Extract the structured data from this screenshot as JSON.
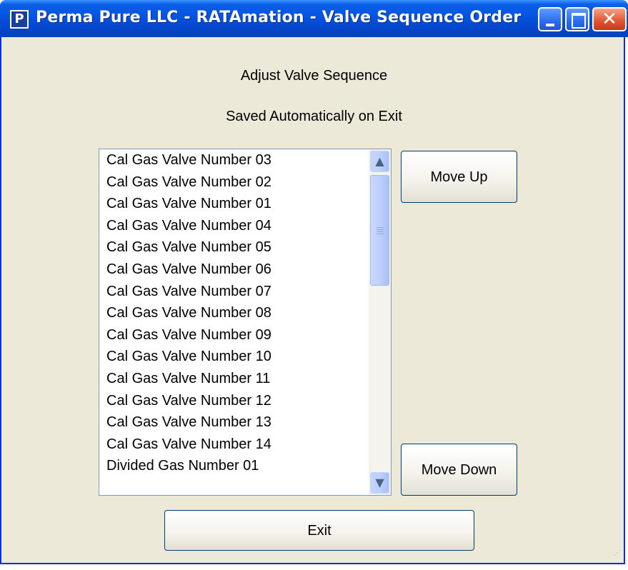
{
  "window": {
    "title": "Perma Pure LLC - RATAmation - Valve Sequence Order",
    "icon_letter": "P",
    "minimize_glyph": "",
    "close_glyph": "✕"
  },
  "labels": {
    "heading": "Adjust Valve Sequence",
    "subheading": "Saved Automatically on Exit"
  },
  "valve_list": {
    "items": [
      "Cal Gas Valve Number 03",
      "Cal Gas Valve Number 02",
      "Cal Gas Valve Number 01",
      "Cal Gas Valve Number 04",
      "Cal Gas Valve Number 05",
      "Cal Gas Valve Number 06",
      "Cal Gas Valve Number 07",
      "Cal Gas Valve Number 08",
      "Cal Gas Valve Number 09",
      "Cal Gas Valve Number 10",
      "Cal Gas Valve Number 11",
      "Cal Gas Valve Number 12",
      "Cal Gas Valve Number 13",
      "Cal Gas Valve Number 14",
      "Divided Gas Number 01"
    ],
    "scroll_up_glyph": "▲",
    "scroll_down_glyph": "▼"
  },
  "buttons": {
    "move_up": "Move Up",
    "move_down": "Move Down",
    "exit": "Exit"
  }
}
